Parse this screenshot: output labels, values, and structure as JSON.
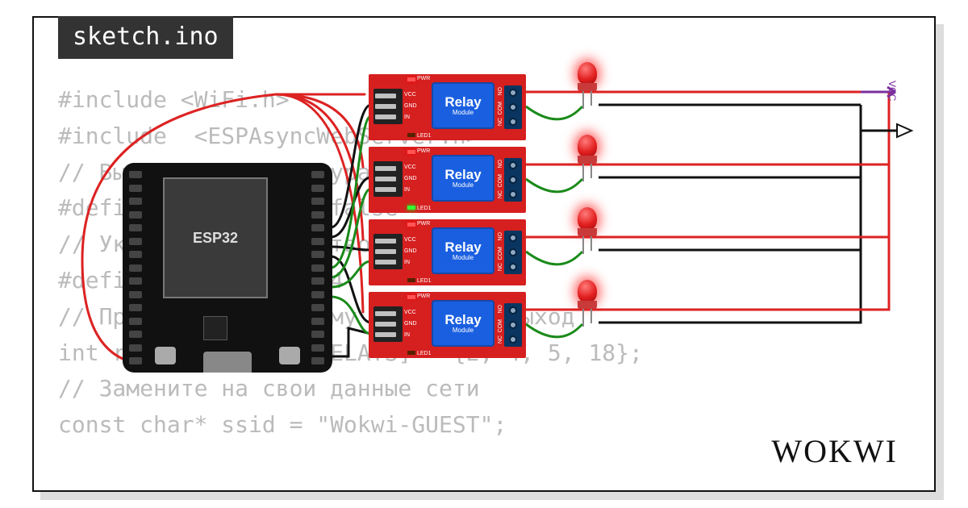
{
  "tab_title": "sketch.ino",
  "logo_text": "WOKWI",
  "code_lines": [
    "#include <WiFi.h>",
    "#include  <ESPAsyncWebServer.h>",
    "// Выставляем конфигурацию NC / NO",
    "#define RELAY_NO    false",
    "// Указываем количество реле",
    "#define NUM_RELAYS  4",
    "// Присваиваем каждому реле свой выход",
    "int relayGPIOs[NUM_RELAYS] = {2, 4, 5, 18};",
    "// Замените на свои данные сети",
    "const char* ssid = \"Wokwi-GUEST\";"
  ],
  "esp32": {
    "label": "ESP32",
    "pin_count": 15
  },
  "relay_common": {
    "box_line1": "Relay",
    "box_line2": "Module",
    "pwr_label": "PWR",
    "led_label": "LED1",
    "in_labels": [
      "VCC",
      "GND",
      "IN"
    ],
    "out_labels": [
      "NO",
      "COM",
      "NC"
    ]
  },
  "relays": [
    {
      "led_on": false
    },
    {
      "led_on": true
    },
    {
      "led_on": false
    },
    {
      "led_on": false
    }
  ],
  "leds": [
    {},
    {},
    {},
    {}
  ],
  "rail": {
    "vcc_label": "VCC"
  },
  "colors": {
    "wire_red": "#d22",
    "wire_black": "#111",
    "wire_green": "#1a8a1a",
    "wire_purple": "#7a2f9e"
  }
}
